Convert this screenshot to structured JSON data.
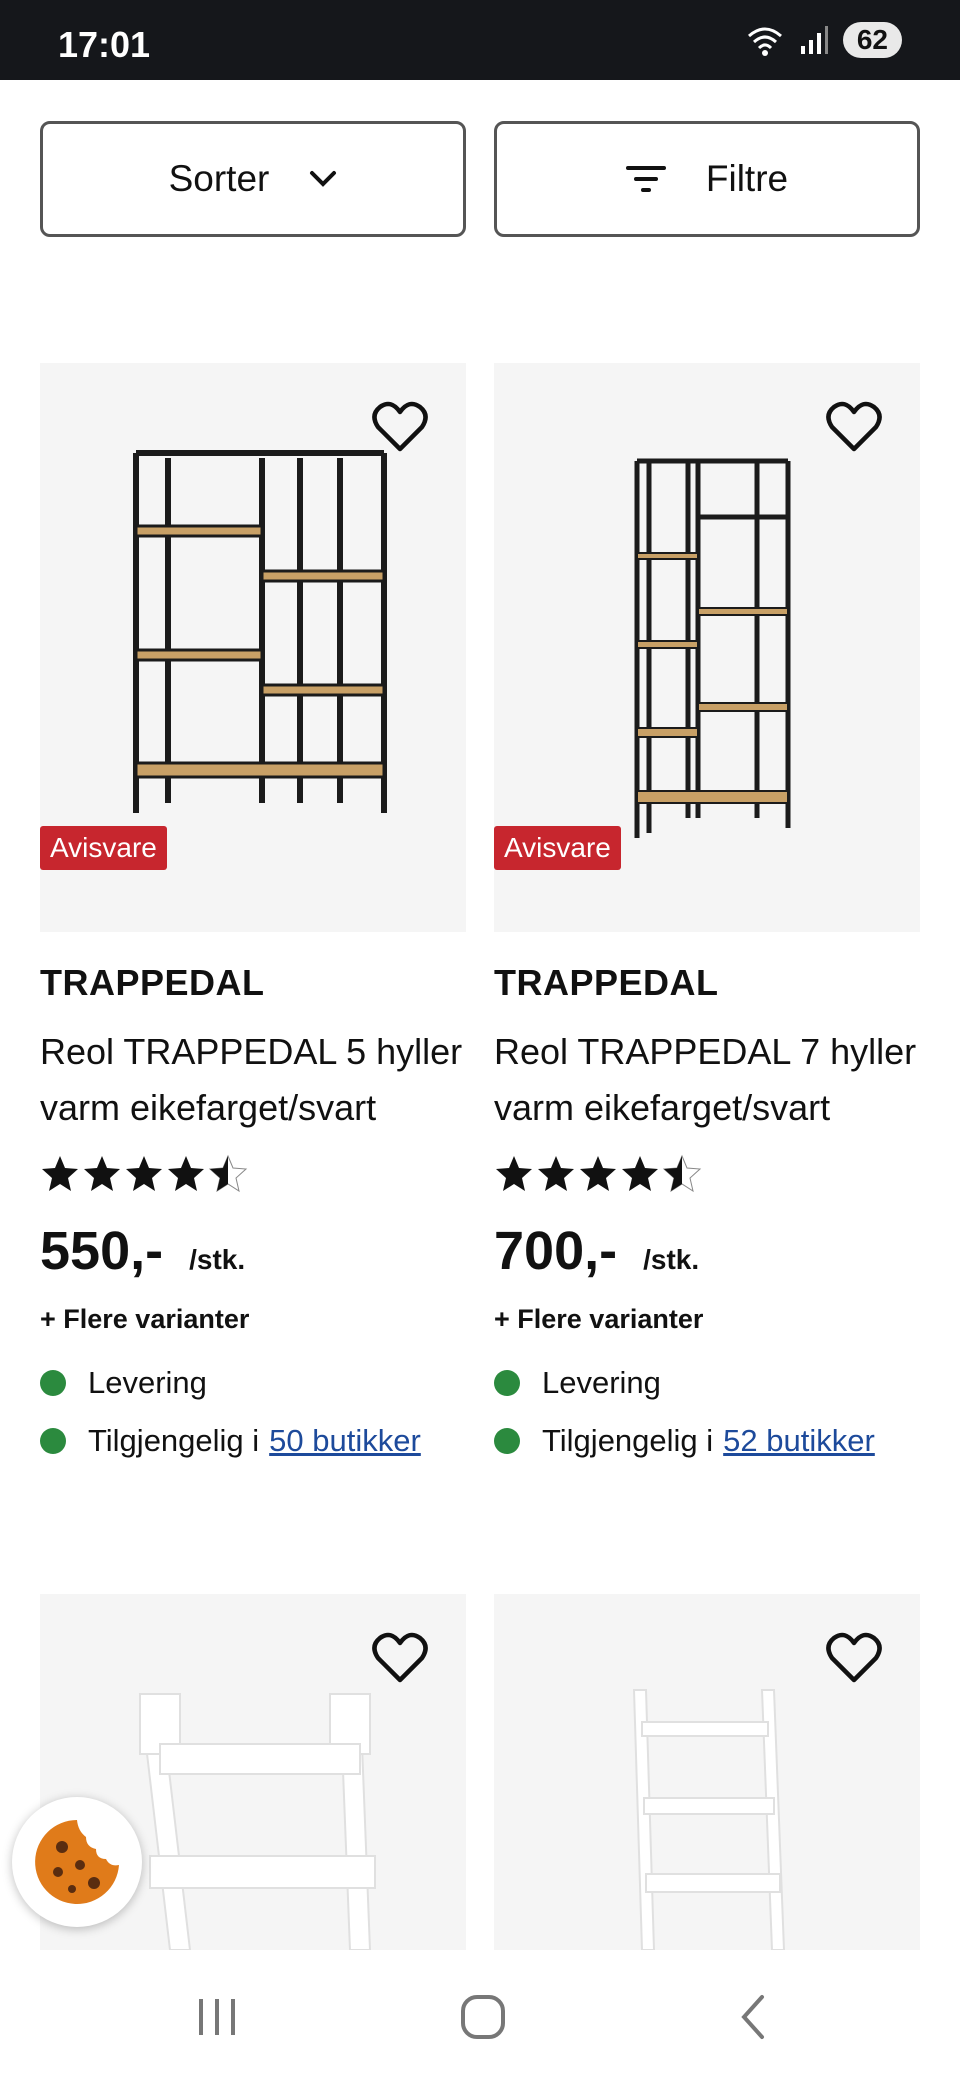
{
  "status_bar": {
    "time": "17:01",
    "battery": "62"
  },
  "toolbar": {
    "sort_label": "Sorter",
    "filter_label": "Filtre"
  },
  "products": [
    {
      "badge": "Avisvare",
      "brand": "TRAPPEDAL",
      "title": "Reol TRAPPEDAL 5 hyller varm eikefarget/svart",
      "rating": 4.5,
      "price": "550,-",
      "unit": "/stk.",
      "variants": "+ Flere varianter",
      "delivery": "Levering",
      "availability_prefix": "Tilgjengelig i",
      "availability_link": "50 butikker"
    },
    {
      "badge": "Avisvare",
      "brand": "TRAPPEDAL",
      "title": "Reol TRAPPEDAL 7 hyller varm eikefarget/svart",
      "rating": 4.5,
      "price": "700,-",
      "unit": "/stk.",
      "variants": "+ Flere varianter",
      "delivery": "Levering",
      "availability_prefix": "Tilgjengelig i",
      "availability_link": "52 butikker"
    }
  ],
  "colors": {
    "badge": "#c7262e",
    "availability_dot": "#2b8a3e",
    "link": "#1d4a9b",
    "status_bar": "#15171b"
  }
}
